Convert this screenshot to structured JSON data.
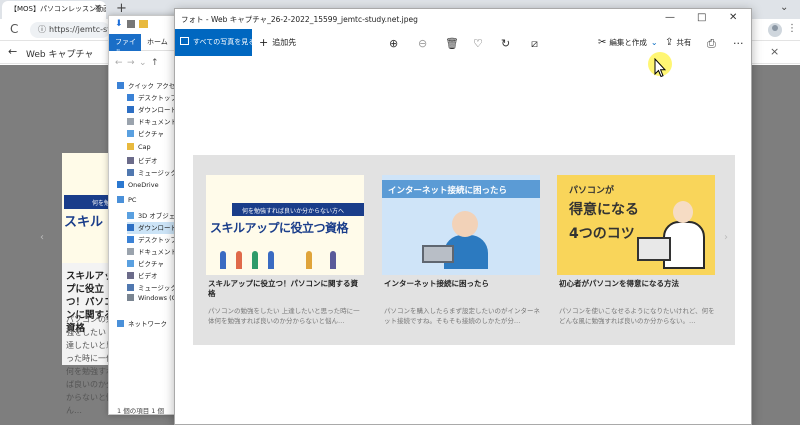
{
  "browser": {
    "tab_title": "【MOS】パソコンレッスン動画〜もっと",
    "tab_close": "×",
    "new_tab": "+",
    "tab_overflow": "⌄",
    "reload": "C",
    "url": "https://jemtc-st",
    "lock": "ⓘ",
    "menu": "⋮",
    "back": "←",
    "header_title": "Web キャプチャ",
    "close": "×",
    "card": {
      "banner": "何を勉",
      "big_text": "スキル",
      "title": "スキルアップに役立つ！パソコンに関する資格",
      "desc": "パソコンの勉強をしたい 上達したいと思った時に一体何を勉強すれば良いのか分からないと悩ん…"
    }
  },
  "explorer": {
    "ribbon_file": "ファイル",
    "ribbon_home": "ホーム",
    "status": "1 個の項目  1 個",
    "items": [
      {
        "label": "クイック アクセス",
        "color": "#3b82d6",
        "level": 0
      },
      {
        "label": "デスクトップ",
        "color": "#3b82d6",
        "level": 1
      },
      {
        "label": "ダウンロード",
        "color": "#2d6fc4",
        "level": 1
      },
      {
        "label": "ドキュメント",
        "color": "#9aa3ad",
        "level": 1
      },
      {
        "label": "ピクチャ",
        "color": "#5aa0e0",
        "level": 1
      },
      {
        "label": "Cap",
        "color": "#e8b93e",
        "level": 1
      },
      {
        "label": "ビデオ",
        "color": "#6b6b8a",
        "level": 1
      },
      {
        "label": "ミュージック",
        "color": "#5078b0",
        "level": 1
      },
      {
        "label": "OneDrive",
        "color": "#2b78d0",
        "level": 0
      },
      {
        "label": "PC",
        "color": "#4a90d9",
        "level": 0
      },
      {
        "label": "3D オブジェクト",
        "color": "#5aa0e0",
        "level": 1
      },
      {
        "label": "ダウンロード",
        "color": "#2d6fc4",
        "level": 1
      },
      {
        "label": "デスクトップ",
        "color": "#3b82d6",
        "level": 1
      },
      {
        "label": "ドキュメント",
        "color": "#9aa3ad",
        "level": 1
      },
      {
        "label": "ピクチャ",
        "color": "#5aa0e0",
        "level": 1
      },
      {
        "label": "ビデオ",
        "color": "#6b6b8a",
        "level": 1
      },
      {
        "label": "ミュージック",
        "color": "#5078b0",
        "level": 1
      },
      {
        "label": "Windows (C:)",
        "color": "#7a8591",
        "level": 1
      },
      {
        "label": "ネットワーク",
        "color": "#4a90d9",
        "level": 0
      }
    ]
  },
  "photos": {
    "title": "フォト - Web キャプチャ_26-2-2022_15599_jemtc-study.net.jpeg",
    "window": {
      "minimize": "—",
      "maximize": "□",
      "close": "✕"
    },
    "toolbar": {
      "all_photos": "すべての写真を見る",
      "add_to": "追加先",
      "add_plus": "+",
      "zoom_in": "⊕",
      "zoom_out": "⊖",
      "delete": "🗑",
      "favorite": "♡",
      "rotate": "↻",
      "crop": "⧄",
      "edit_create": "編集と作成",
      "edit_icon": "✂",
      "edit_chevron": "⌄",
      "share": "共有",
      "share_icon": "⇪",
      "print": "⎙",
      "more": "···"
    },
    "cards": [
      {
        "image_ribbon": "何を勉強すれば良いか分からない方へ",
        "image_big": "スキルアップに役立つ資格",
        "title": "スキルアップに役立つ！パソコンに関する資格",
        "desc": "パソコンの勉強をしたい 上達したいと思った時に一体何を勉強すれば良いのか分からないと悩ん…"
      },
      {
        "image_header": "インターネット接続に困ったら",
        "title": "インターネット接続に困ったら",
        "desc": "パソコンを購入したらまず設定したいのがインターネット接続ですね。そもそも接続のしかたが分…"
      },
      {
        "image_line1": "パソコンが",
        "image_line2": "得意になる",
        "image_line3": "4つのコツ",
        "title": "初心者がパソコンを得意になる方法",
        "desc": "パソコンを使いこなせるようになりたいけれど、何をどんな風に勉強すれば良いのか分からない。…"
      }
    ],
    "nav_left": "‹",
    "nav_right": "›"
  },
  "colors": {
    "accent": "#0067c0",
    "highlight": "#fff000"
  }
}
